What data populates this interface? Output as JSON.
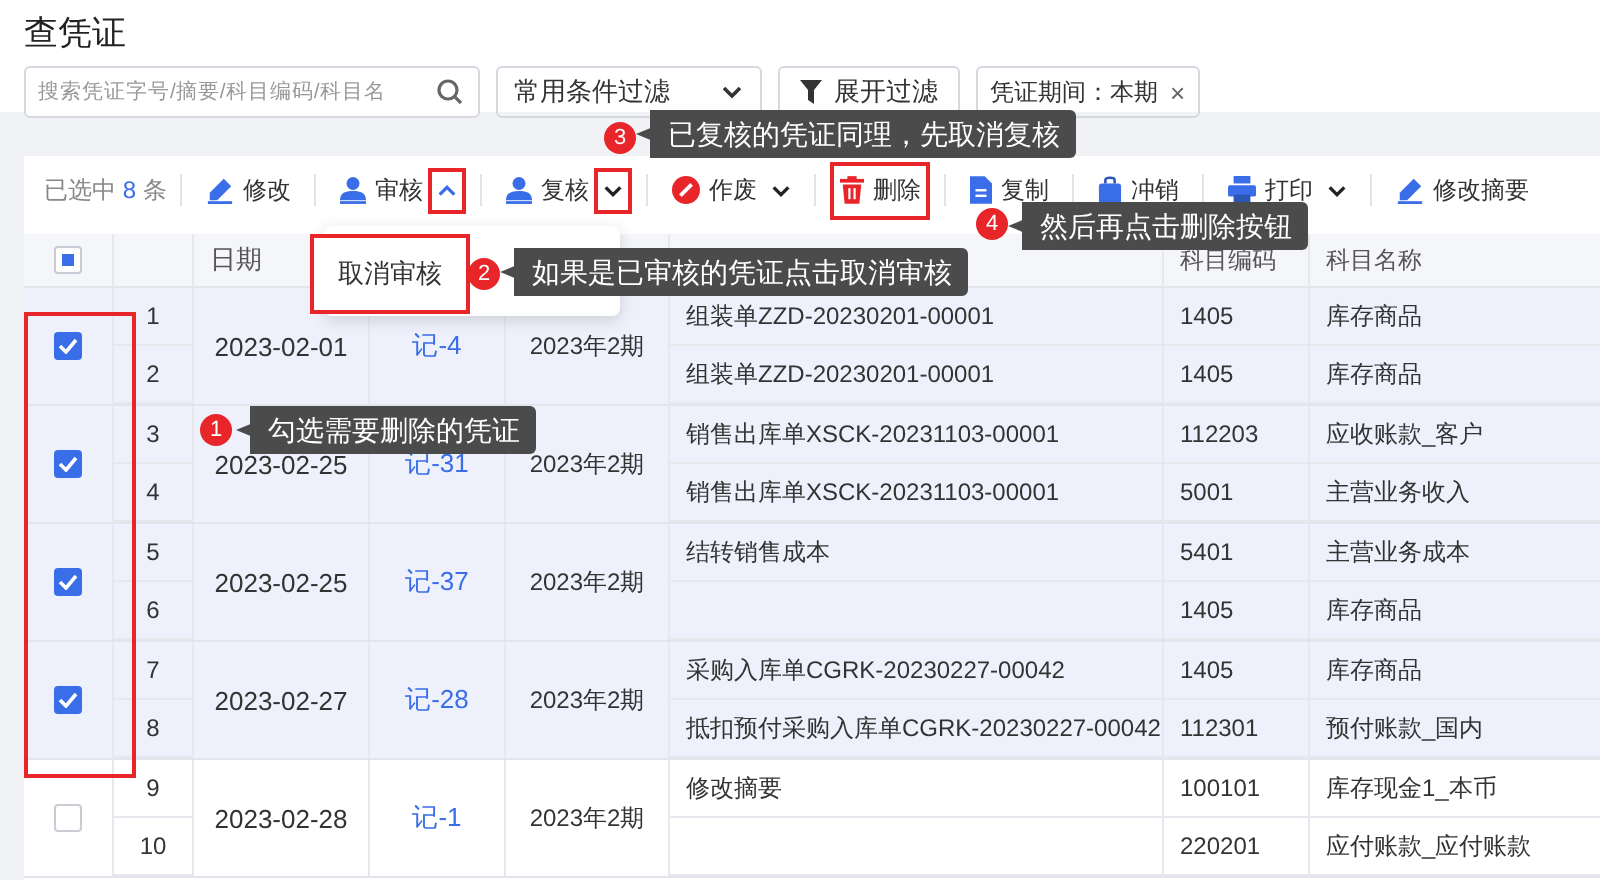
{
  "page_title": "查凭证",
  "filters": {
    "search": {
      "placeholder": "搜索凭证字号/摘要/科目编码/科目名"
    },
    "preset": {
      "label": "常用条件过滤"
    },
    "expand": {
      "label": "展开过滤"
    },
    "tag": {
      "label": "凭证期间：本期",
      "close": "×"
    }
  },
  "toolbar": {
    "selected_count": {
      "prefix": "已选中",
      "count": "8",
      "suffix": "条"
    },
    "items": [
      {
        "label": "修改",
        "highlighted": false
      },
      {
        "label": "审核",
        "highlighted": false,
        "dropdown": {
          "open": true,
          "highlighted": true
        }
      },
      {
        "label": "复核",
        "highlighted": false,
        "dropdown": {
          "open": false,
          "highlighted": true
        }
      },
      {
        "label": "作废",
        "highlighted": false,
        "dropdown": {
          "open": false,
          "highlighted": false
        }
      },
      {
        "label": "删除",
        "highlighted": true
      },
      {
        "label": "复制",
        "highlighted": false
      },
      {
        "label": "冲销",
        "highlighted": false
      },
      {
        "label": "打印",
        "highlighted": false,
        "dropdown": {
          "open": false,
          "highlighted": false
        }
      },
      {
        "label": "修改摘要",
        "highlighted": false
      }
    ]
  },
  "dropdown": {
    "items": [
      {
        "label": "取消审核",
        "highlighted": true
      }
    ]
  },
  "table": {
    "select_all": {
      "indeterminate": true
    },
    "checkbox_highlight": true,
    "columns": [
      "日期",
      "科目编码",
      "科目名称"
    ],
    "groups": [
      {
        "checked": true,
        "date": "2023-02-01",
        "voucher": "记-4",
        "period": "2023年2期",
        "lines": [
          {
            "index": "1",
            "summary": "组装单ZZD-20230201-00001",
            "code": "1405",
            "name": "库存商品"
          },
          {
            "index": "2",
            "summary": "组装单ZZD-20230201-00001",
            "code": "1405",
            "name": "库存商品"
          }
        ]
      },
      {
        "checked": true,
        "date": "2023-02-25",
        "voucher": "记-31",
        "period": "2023年2期",
        "lines": [
          {
            "index": "3",
            "summary": "销售出库单XSCK-20231103-00001",
            "code": "112203",
            "name": "应收账款_客户"
          },
          {
            "index": "4",
            "summary": "销售出库单XSCK-20231103-00001",
            "code": "5001",
            "name": "主营业务收入"
          }
        ]
      },
      {
        "checked": true,
        "date": "2023-02-25",
        "voucher": "记-37",
        "period": "2023年2期",
        "lines": [
          {
            "index": "5",
            "summary": "结转销售成本",
            "code": "5401",
            "name": "主营业务成本"
          },
          {
            "index": "6",
            "code": "1405",
            "name": "库存商品"
          }
        ]
      },
      {
        "checked": true,
        "date": "2023-02-27",
        "voucher": "记-28",
        "period": "2023年2期",
        "lines": [
          {
            "index": "7",
            "summary": "采购入库单CGRK-20230227-00042",
            "code": "1405",
            "name": "库存商品"
          },
          {
            "index": "8",
            "summary": "抵扣预付采购入库单CGRK-20230227-00042",
            "code": "112301",
            "name": "预付账款_国内"
          }
        ]
      },
      {
        "checked": false,
        "date": "2023-02-28",
        "voucher": "记-1",
        "period": "2023年2期",
        "lines": [
          {
            "index": "9",
            "summary": "修改摘要",
            "code": "100101",
            "name": "库存现金1_本币"
          },
          {
            "index": "10",
            "code": "220201",
            "name": "应付账款_应付账款"
          }
        ]
      }
    ]
  },
  "callouts": [
    {
      "step": "1",
      "text": "勾选需要删除的凭证"
    },
    {
      "step": "2",
      "text": "如果是已审核的凭证点击取消审核"
    },
    {
      "step": "3",
      "text": "已复核的凭证同理，先取消复核"
    },
    {
      "step": "4",
      "text": "然后再点击删除按钮"
    }
  ]
}
